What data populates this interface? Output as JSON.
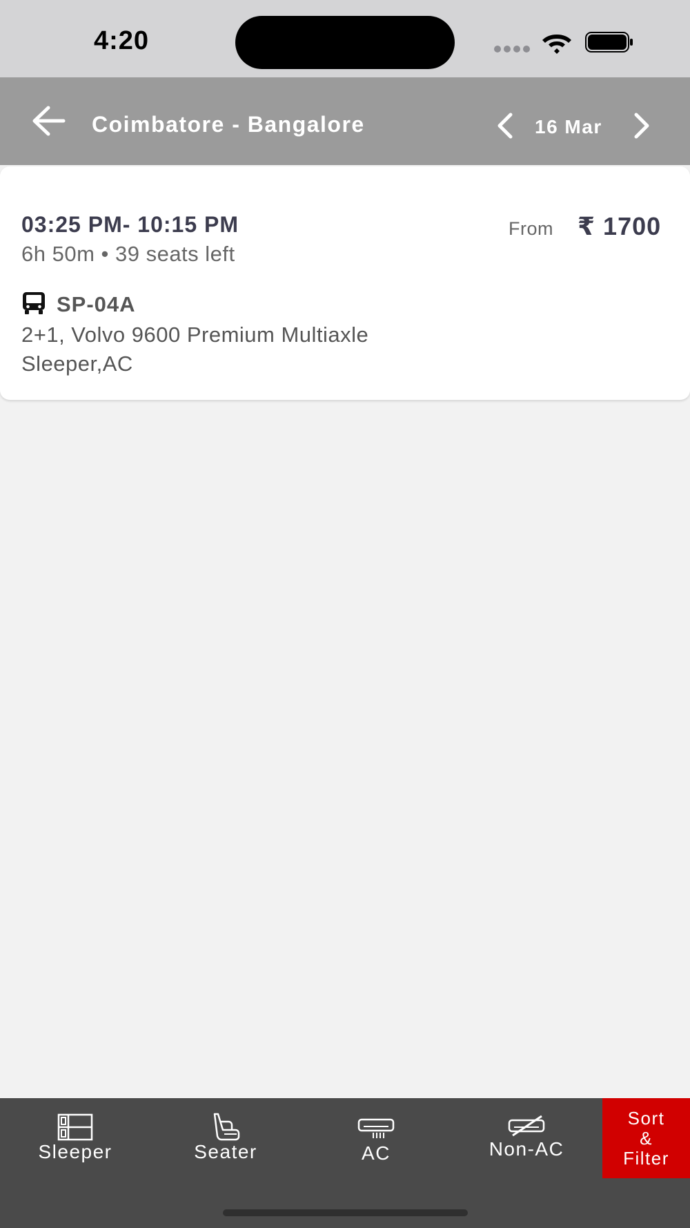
{
  "status_bar": {
    "time": "4:20",
    "icons": [
      "signal-dots-icon",
      "wifi-icon",
      "battery-icon"
    ]
  },
  "header": {
    "back_icon": "arrow-left-icon",
    "title": "Coimbatore - Bangalore",
    "prev_icon": "chevron-left-icon",
    "date": "16 Mar",
    "next_icon": "chevron-right-icon"
  },
  "buses": [
    {
      "time_range": "03:25 PM- 10:15 PM",
      "duration_seats": "6h 50m • 39 seats left",
      "from_label": "From",
      "price": "₹ 1700",
      "icon": "bus-icon",
      "code": "SP-04A",
      "bus_type": "2+1, Volvo 9600 Premium Multiaxle Sleeper,AC"
    }
  ],
  "filters": [
    {
      "label": "Sleeper",
      "icon": "sleeper-icon"
    },
    {
      "label": "Seater",
      "icon": "seater-icon"
    },
    {
      "label": "AC",
      "icon": "ac-icon"
    },
    {
      "label": "Non-AC",
      "icon": "non-ac-icon"
    }
  ],
  "sort_filter": {
    "lines": [
      "Sort",
      "&",
      "Filter"
    ]
  },
  "colors": {
    "status_bar_bg": "#d4d4d6",
    "header_bg": "#9b9b9b",
    "page_bg": "#f2f2f2",
    "card_bg": "#ffffff",
    "filter_bar_bg": "#4a4a4a",
    "sort_filter_bg": "#d10000",
    "primary_text": "#3c3c4e"
  }
}
